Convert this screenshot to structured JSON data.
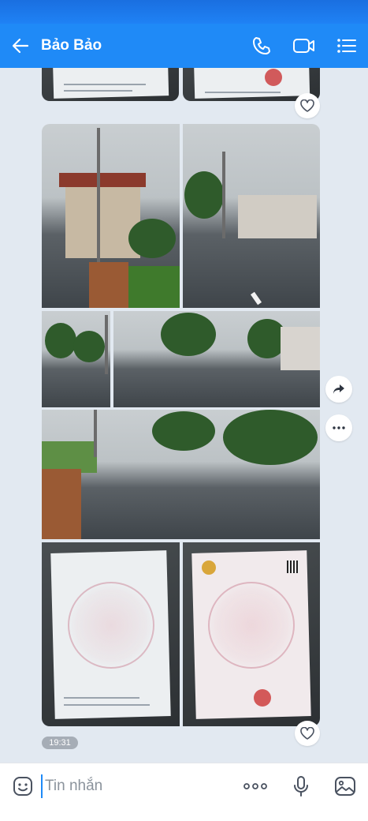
{
  "header": {
    "contact_name": "Bảo Bảo"
  },
  "message": {
    "time": "19:31"
  },
  "composer": {
    "placeholder": "Tin nhắn"
  },
  "icons": {
    "back": "arrow-left-icon",
    "call": "phone-icon",
    "video": "video-call-icon",
    "menu": "list-menu-icon",
    "like": "heart-icon",
    "share": "share-arrow-icon",
    "more": "more-dots-icon",
    "sticker": "sticker-smile-icon",
    "more_options": "ellipsis-icon",
    "mic": "microphone-icon",
    "gallery": "image-gallery-icon"
  },
  "colors": {
    "header": "#1f8af7",
    "background": "#e2e9f1",
    "accent": "#1f8af7"
  }
}
